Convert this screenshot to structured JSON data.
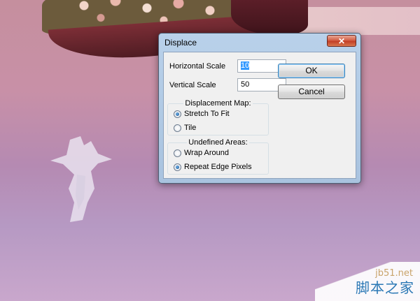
{
  "dialog": {
    "title": "Displace",
    "close_icon": "close-icon",
    "horizontal_scale": {
      "label": "Horizontal Scale",
      "value": "10"
    },
    "vertical_scale": {
      "label": "Vertical Scale",
      "value": "50"
    },
    "ok_label": "OK",
    "cancel_label": "Cancel",
    "displacement_map": {
      "title": "Displacement Map:",
      "options": [
        {
          "label": "Stretch To Fit",
          "checked": true
        },
        {
          "label": "Tile",
          "checked": false
        }
      ]
    },
    "undefined_areas": {
      "title": "Undefined Areas:",
      "options": [
        {
          "label": "Wrap Around",
          "checked": false
        },
        {
          "label": "Repeat Edge Pixels",
          "checked": true
        }
      ]
    }
  },
  "watermark": {
    "domain": "jb51.net",
    "name": "脚本之家"
  },
  "colors": {
    "close_button": "#c9482e",
    "title_bar": "#b9d1ea",
    "client_bg": "#f0f0f0"
  }
}
